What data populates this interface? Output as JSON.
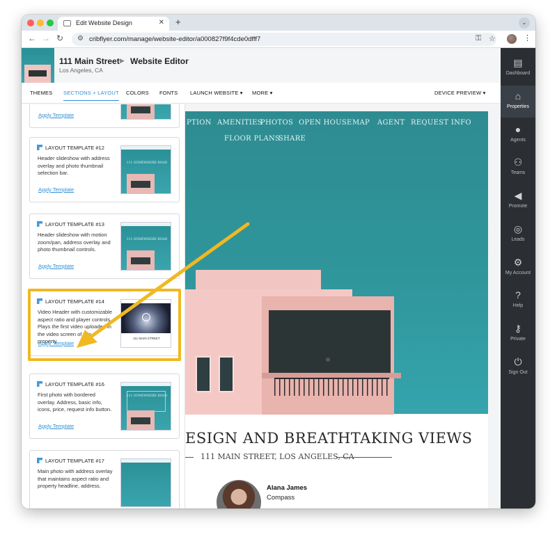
{
  "browser": {
    "tab_title": "Edit Website Design",
    "new_tab": "+",
    "close": "✕",
    "url": "cribflyer.com/manage/website-editor/a000827f9f4cde0dfff7"
  },
  "header": {
    "property_title": "111 Main Street",
    "property_location": "Los Angeles, CA",
    "breadcrumb_current": "Website Editor"
  },
  "nav": {
    "themes": "THEMES",
    "sections_layout": "SECTIONS + LAYOUT",
    "colors": "COLORS",
    "fonts": "FONTS",
    "launch_website": "LAUNCH WEBSITE ▾",
    "more": "MORE ▾",
    "device_preview": "DEVICE PREVIEW ▾"
  },
  "sidebar": {
    "items": [
      {
        "label": "Dashboard",
        "icon": "dashboard-icon"
      },
      {
        "label": "Properties",
        "icon": "properties-icon"
      },
      {
        "label": "Agents",
        "icon": "agents-icon"
      },
      {
        "label": "Teams",
        "icon": "teams-icon"
      },
      {
        "label": "Promote",
        "icon": "megaphone-icon"
      },
      {
        "label": "Leads",
        "icon": "target-icon"
      },
      {
        "label": "My Account",
        "icon": "gear-icon"
      },
      {
        "label": "Help",
        "icon": "help-icon"
      },
      {
        "label": "Private",
        "icon": "key-icon"
      },
      {
        "label": "Sign Out",
        "icon": "power-icon"
      }
    ],
    "active": "Properties"
  },
  "templates": {
    "apply_label": "Apply Template",
    "cards": [
      {
        "title": "",
        "description": ""
      },
      {
        "title": "LAYOUT TEMPLATE #12",
        "description": "Header slideshow with address overlay and photo thumbnail selection bar.",
        "preview_text": "111 SOMEWHERE ROAD"
      },
      {
        "title": "LAYOUT TEMPLATE #13",
        "description": "Header slideshow with motion zoom/pan, address overlay and photo thumbnail controls.",
        "preview_text": "111 SOMEWHERE ROAD"
      },
      {
        "title": "LAYOUT TEMPLATE #14",
        "description": "Video Header with customizable aspect ratio and player controls. Plays the first video uploaded in the video screen of this property.",
        "preview_text": "111 MAIN STREET"
      },
      {
        "title": "LAYOUT TEMPLATE #16",
        "description": "First photo with bordered overlay. Address, basic info, icons, price, request info button.",
        "preview_text": "111 SOMEWHERE ROAD"
      },
      {
        "title": "LAYOUT TEMPLATE #17",
        "description": "Main photo with address overlay that maintains aspect ratio and property headline, address.",
        "preview_text": ""
      }
    ],
    "highlighted_index": 3,
    "highlight_color": "#f0b822"
  },
  "site_preview": {
    "menu": [
      "PTION",
      "AMENITIES",
      "PHOTOS",
      "OPEN HOUSE",
      "MAP",
      "AGENT",
      "REQUEST INFO",
      "FLOOR PLANS",
      "SHARE"
    ],
    "headline": "ESIGN AND BREATHTAKING VIEWS",
    "address": "111 MAIN STREET, LOS ANGELES, CA",
    "agent_name": "Alana James",
    "agent_company": "Compass"
  },
  "colors": {
    "accent": "#2f8fd6",
    "sidebar_bg": "#2b2f33",
    "hero_teal": "#2f969c",
    "annotation": "#f0b822"
  }
}
